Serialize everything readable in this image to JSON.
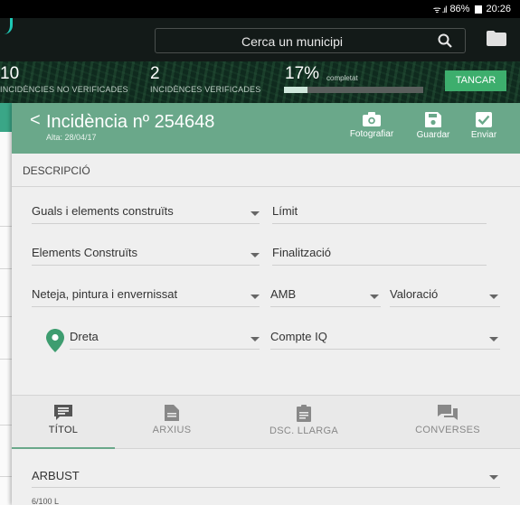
{
  "status_bar": {
    "battery": "86%",
    "time": "20:26"
  },
  "search": {
    "placeholder": "Cerca un municipi"
  },
  "stats": {
    "unverified_count": "10",
    "unverified_label": "INCIDÈNCIES NO VERIFICADES",
    "verified_count": "2",
    "verified_label": "INCIDÈNCES VERIFICADES",
    "percent": "17%",
    "percent_label": "completat",
    "progress": 0.17,
    "close_label": "TANCAR"
  },
  "incident": {
    "back_glyph": "<",
    "title": "Incidència nº 254648",
    "subtitle": "Alta: 28/04/17",
    "actions": [
      {
        "label": "Fotografiar",
        "icon": "camera-icon"
      },
      {
        "label": "Guardar",
        "icon": "save-icon"
      },
      {
        "label": "Enviar",
        "icon": "check-icon"
      }
    ]
  },
  "section_title": "DESCRIPCIÓ",
  "fields": {
    "category": "Guals i elements construïts",
    "limit": "Límit",
    "subcategory": "Elements Construïts",
    "completion": "Finalització",
    "task": "Neteja, pintura i envernissat",
    "amb": "AMB",
    "rating": "Valoració",
    "side": "Dreta",
    "iq_account": "Compte IQ"
  },
  "tabs": [
    {
      "label": "TÍTOL",
      "icon": "message-icon",
      "active": true
    },
    {
      "label": "ARXIUS",
      "icon": "file-icon",
      "active": false
    },
    {
      "label": "DSC. LLARGA",
      "icon": "clipboard-icon",
      "active": false
    },
    {
      "label": "CONVERSES",
      "icon": "chat-icon",
      "active": false
    }
  ],
  "title_field": {
    "value": "ARBUST",
    "counter": "6/100 L"
  },
  "colors": {
    "accent": "#6aa88a",
    "button": "#3dae6d",
    "teal": "#1ec8b5"
  }
}
